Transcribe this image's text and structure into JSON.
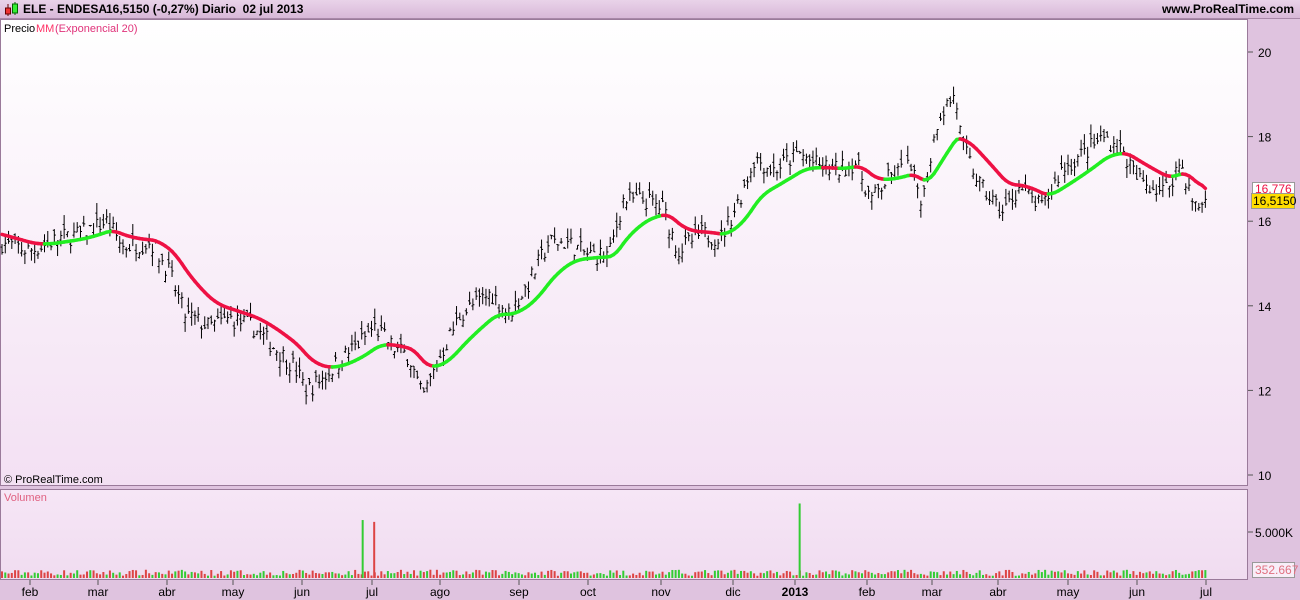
{
  "header": {
    "symbol": "ELE - ENDESA",
    "price_change": "16,5150 (-0,27%)",
    "period_date": "Diario  02 jul 2013",
    "site": "www.ProRealTime.com",
    "icon": "candlestick-icon"
  },
  "legend": {
    "price": "Precio",
    "ma_name": "MM",
    "ma_params": "(Exponencial 20)"
  },
  "copyright": "© ProRealTime.com",
  "volume_label": "Volumen",
  "markers": {
    "ma_last": "16.776",
    "price_last": "16,5150",
    "volume_last": "352.667"
  },
  "colors": {
    "ma_up": "#22ee22",
    "ma_down": "#ee1144",
    "bars": "#000000",
    "marker_yellow": "#ffdd00",
    "vol_up": "#33cc33",
    "vol_down": "#dd4444"
  },
  "chart_data": [
    {
      "type": "ohlc-bar",
      "title": "ELE - ENDESA",
      "y_axis": {
        "ticks": [
          "20",
          "18",
          "16",
          "14",
          "12",
          "10"
        ],
        "ylim": [
          10,
          20.5
        ],
        "position": "right"
      },
      "x_axis": {
        "ticks": [
          "feb",
          "mar",
          "abr",
          "may",
          "jun",
          "jul",
          "ago",
          "sep",
          "oct",
          "nov",
          "dic",
          "2013",
          "feb",
          "mar",
          "abr",
          "may",
          "jun",
          "jul"
        ]
      },
      "grid": false,
      "series": [
        {
          "name": "Precio",
          "type": "ohlc",
          "approx_closes": [
            [
              "2012-01-19",
              15.5
            ],
            [
              "2012-02-01",
              15.3
            ],
            [
              "2012-02-14",
              15.6
            ],
            [
              "2012-02-23",
              15.7
            ],
            [
              "2012-03-05",
              16.0
            ],
            [
              "2012-03-12",
              15.4
            ],
            [
              "2012-03-25",
              15.5
            ],
            [
              "2012-04-02",
              14.8
            ],
            [
              "2012-04-09",
              13.8
            ],
            [
              "2012-04-20",
              13.5
            ],
            [
              "2012-04-30",
              13.7
            ],
            [
              "2012-05-10",
              13.5
            ],
            [
              "2012-05-20",
              13.0
            ],
            [
              "2012-05-28",
              12.6
            ],
            [
              "2012-06-03",
              12.0
            ],
            [
              "2012-06-10",
              12.3
            ],
            [
              "2012-06-19",
              12.8
            ],
            [
              "2012-06-27",
              13.2
            ],
            [
              "2012-07-02",
              13.5
            ],
            [
              "2012-07-11",
              13.0
            ],
            [
              "2012-07-18",
              12.8
            ],
            [
              "2012-07-24",
              11.8
            ],
            [
              "2012-08-01",
              12.8
            ],
            [
              "2012-08-09",
              13.8
            ],
            [
              "2012-08-21",
              14.3
            ],
            [
              "2012-08-28",
              13.8
            ],
            [
              "2012-09-05",
              14.5
            ],
            [
              "2012-09-14",
              15.5
            ],
            [
              "2012-09-22",
              15.5
            ],
            [
              "2012-10-01",
              15.2
            ],
            [
              "2012-10-10",
              15.2
            ],
            [
              "2012-10-16",
              16.5
            ],
            [
              "2012-10-25",
              16.5
            ],
            [
              "2012-11-02",
              16.3
            ],
            [
              "2012-11-08",
              15.3
            ],
            [
              "2012-11-18",
              15.7
            ],
            [
              "2012-11-26",
              15.6
            ],
            [
              "2012-12-04",
              16.5
            ],
            [
              "2012-12-12",
              17.5
            ],
            [
              "2012-12-21",
              17.2
            ],
            [
              "2013-01-03",
              17.6
            ],
            [
              "2013-01-11",
              17.3
            ],
            [
              "2013-01-19",
              17.2
            ],
            [
              "2013-01-27",
              17.4
            ],
            [
              "2013-02-03",
              16.5
            ],
            [
              "2013-02-10",
              17.0
            ],
            [
              "2013-02-19",
              17.3
            ],
            [
              "2013-02-25",
              16.5
            ],
            [
              "2013-03-04",
              18.5
            ],
            [
              "2013-03-12",
              19.0
            ],
            [
              "2013-03-15",
              17.8
            ],
            [
              "2013-03-24",
              16.8
            ],
            [
              "2013-04-03",
              16.2
            ],
            [
              "2013-04-10",
              16.8
            ],
            [
              "2013-04-20",
              16.3
            ],
            [
              "2013-04-28",
              17.2
            ],
            [
              "2013-05-08",
              17.6
            ],
            [
              "2013-05-17",
              18.0
            ],
            [
              "2013-05-25",
              17.7
            ],
            [
              "2013-06-01",
              17.0
            ],
            [
              "2013-06-13",
              16.7
            ],
            [
              "2013-06-20",
              17.4
            ],
            [
              "2013-06-26",
              16.3
            ],
            [
              "2013-07-02",
              16.515
            ]
          ]
        },
        {
          "name": "MM (Exponencial 20)",
          "type": "line",
          "period": 20,
          "last": 16.776
        }
      ]
    },
    {
      "type": "bar",
      "title": "Volumen",
      "y_axis": {
        "ticks": [
          "5.000K"
        ],
        "ylim": [
          0,
          9000000
        ]
      },
      "typical_volume": 600000,
      "last_value": 352667,
      "spikes": [
        [
          "2012-06-27",
          6300000,
          "up"
        ],
        [
          "2012-07-02",
          6100000,
          "down"
        ],
        [
          "2013-01-03",
          8100000,
          "up"
        ]
      ]
    }
  ]
}
